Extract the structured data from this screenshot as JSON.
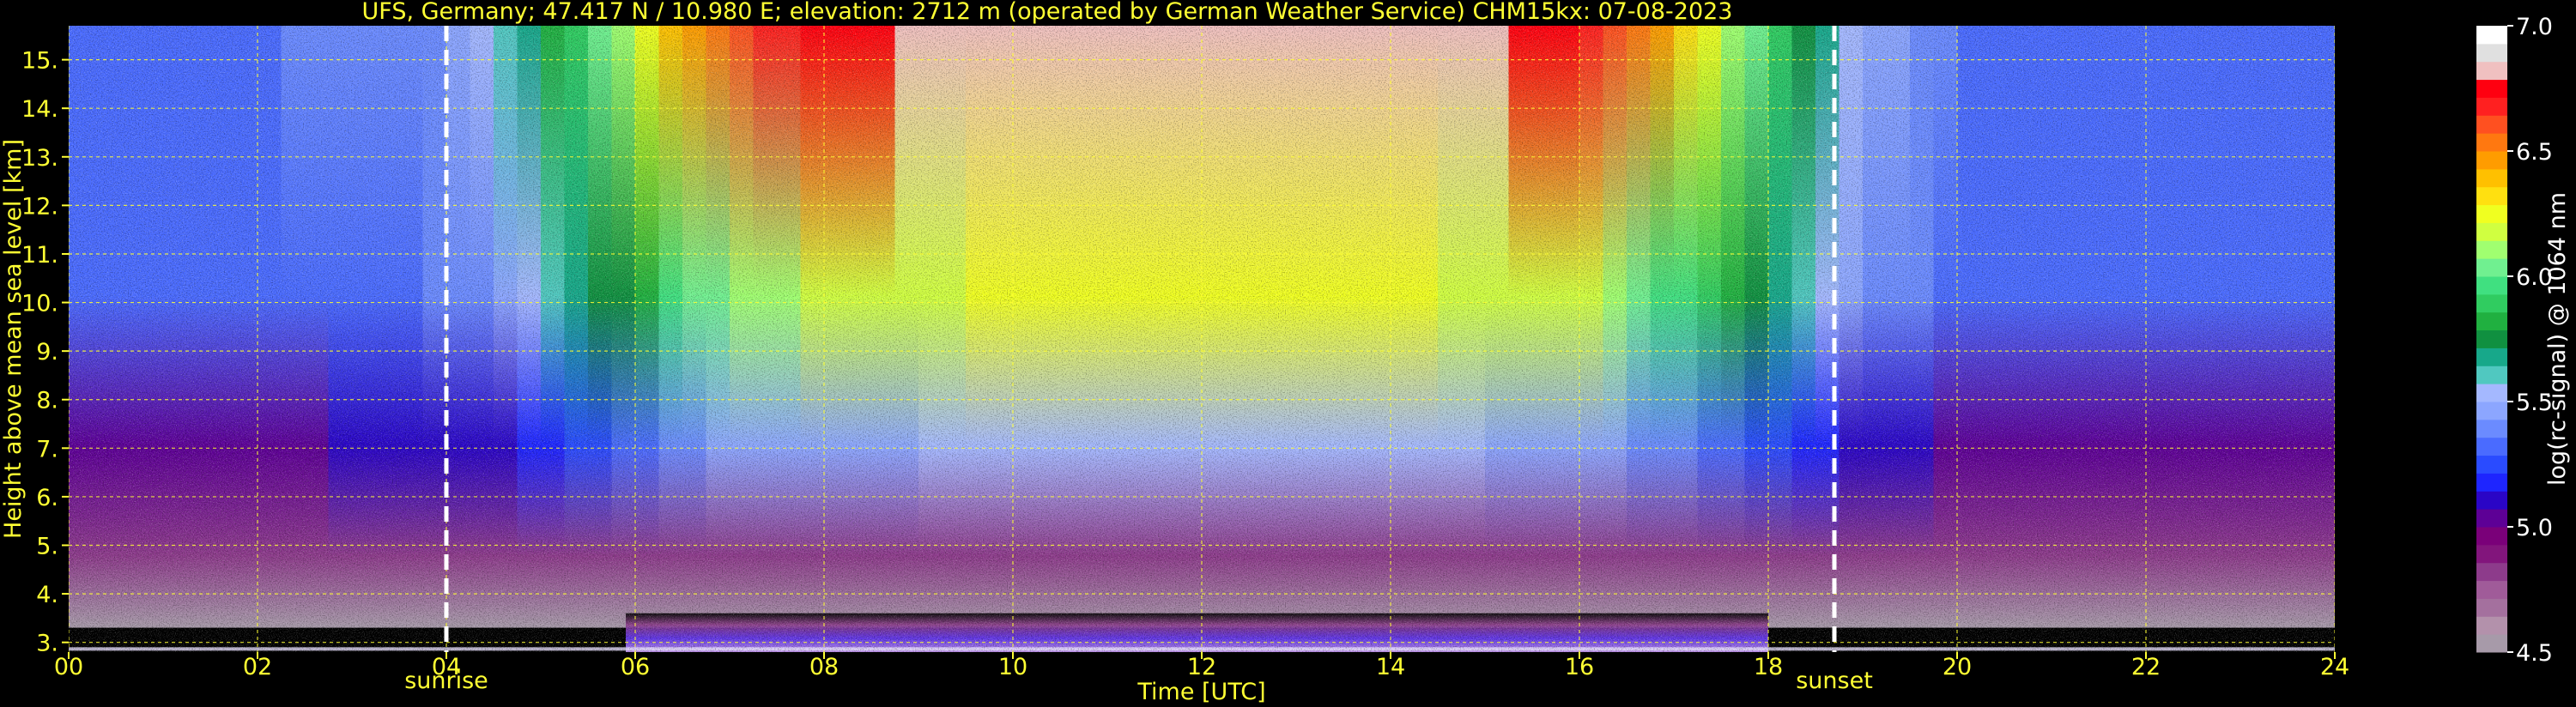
{
  "chart_data": {
    "type": "heatmap",
    "title": "UFS, Germany; 47.417 N / 10.980 E; elevation: 2712 m  (operated by German Weather Service)    CHM15kx: 07-08-2023",
    "xlabel": "Time [UTC]",
    "ylabel": "Height above mean sea level [km]",
    "xlim": [
      0,
      24
    ],
    "ylim": [
      2.8,
      15.7
    ],
    "x_ticks": [
      0,
      2,
      4,
      6,
      8,
      10,
      12,
      14,
      16,
      18,
      20,
      22,
      24
    ],
    "x_tick_labels": [
      "00",
      "02",
      "04",
      "06",
      "08",
      "10",
      "12",
      "14",
      "16",
      "18",
      "20",
      "22",
      "24"
    ],
    "y_ticks": [
      3,
      4,
      5,
      6,
      7,
      8,
      9,
      10,
      11,
      12,
      13,
      14,
      15
    ],
    "y_tick_labels": [
      "3.",
      "4.",
      "5.",
      "6.",
      "7.",
      "8.",
      "9.",
      "10.",
      "11.",
      "12.",
      "13.",
      "14.",
      "15."
    ],
    "grid": true,
    "events": [
      {
        "label": "sunrise",
        "time": 4.0
      },
      {
        "label": "sunset",
        "time": 18.7
      }
    ],
    "colorbar": {
      "label": "log(rc-signal) @ 1064 nm",
      "range": [
        4.5,
        7.0
      ],
      "ticks": [
        4.5,
        5.0,
        5.5,
        6.0,
        6.5,
        7.0
      ],
      "tick_labels": [
        "4.5",
        "5.0",
        "5.5",
        "6.0",
        "6.5",
        "7.0"
      ],
      "colors": [
        "#a79aa9",
        "#b391ab",
        "#a4709e",
        "#a05b99",
        "#8d3b8b",
        "#82157c",
        "#7a0079",
        "#5d0096",
        "#2a05c6",
        "#1e25ff",
        "#2a4bff",
        "#4a6bff",
        "#6b8bff",
        "#8ca6ff",
        "#a4b8ff",
        "#50c8c0",
        "#17a88a",
        "#109040",
        "#20b040",
        "#30cc60",
        "#40e080",
        "#70f090",
        "#a0ff70",
        "#d0ff40",
        "#f0ff20",
        "#ffe010",
        "#ffc000",
        "#ff9c00",
        "#ff7810",
        "#ff5020",
        "#ff2020",
        "#ff0010",
        "#f0c0c0",
        "#e0e0e0",
        "#ffffff"
      ]
    },
    "signal_profile": {
      "times": [
        0,
        2,
        4,
        4.5,
        5.0,
        5.5,
        6.0,
        6.5,
        7,
        8,
        10,
        12,
        14,
        16,
        16.5,
        17,
        17.5,
        18.0,
        18.5,
        19,
        20,
        22,
        24
      ],
      "upper_level": [
        5.35,
        5.35,
        5.4,
        5.55,
        5.75,
        5.95,
        6.15,
        6.45,
        6.6,
        6.75,
        6.85,
        6.85,
        6.85,
        6.75,
        6.6,
        6.4,
        6.2,
        5.95,
        5.7,
        5.5,
        5.35,
        5.3,
        5.3
      ]
    }
  }
}
